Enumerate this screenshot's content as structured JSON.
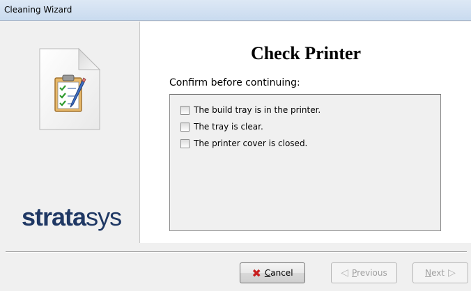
{
  "window": {
    "title": "Cleaning Wizard"
  },
  "left_panel": {
    "logo_bold": "strata",
    "logo_light": "sys"
  },
  "main": {
    "heading": "Check Printer",
    "prompt": "Confirm before continuing:",
    "checklist": [
      {
        "label": "The build tray is in the printer.",
        "checked": false
      },
      {
        "label": "The tray is clear.",
        "checked": false
      },
      {
        "label": "The printer cover is closed.",
        "checked": false
      }
    ]
  },
  "buttons": {
    "cancel": {
      "underline": "C",
      "rest": "ancel",
      "enabled": true
    },
    "previous": {
      "underline": "P",
      "rest": "revious",
      "enabled": false
    },
    "next": {
      "underline": "N",
      "rest": "ext",
      "enabled": false
    }
  },
  "icons": {
    "document": "checklist-document-icon",
    "cancel": "red-x-icon",
    "previous": "arrow-left-icon",
    "next": "arrow-right-icon"
  },
  "colors": {
    "logo": "#1f3864",
    "cancel_x": "#c81e1e",
    "disabled_text": "#a0a0a0"
  }
}
